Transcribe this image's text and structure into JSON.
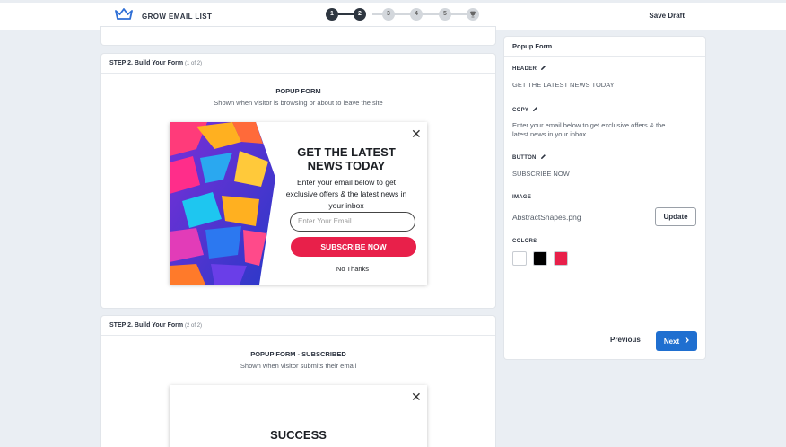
{
  "header": {
    "brand_label": "GROW EMAIL LIST",
    "steps": [
      "1",
      "2",
      "3",
      "4",
      "5"
    ],
    "current_step": 2,
    "save_label": "Save Draft"
  },
  "step1": {
    "heading": "STEP 2. Build Your Form",
    "heading_sub": "(1 of 2)",
    "form_title": "POPUP FORM",
    "form_desc": "Shown when visitor is browsing or about to leave the site",
    "popup": {
      "headline_line1": "GET THE LATEST",
      "headline_line2": "NEWS TODAY",
      "copy_line1": "Enter your email below to get",
      "copy_line2": "exclusive offers & the latest news in",
      "copy_line3": "your inbox",
      "input_placeholder": "Enter Your Email",
      "button_label": "SUBSCRIBE NOW",
      "no_thanks": "No Thanks",
      "close_glyph": "✕"
    }
  },
  "step2": {
    "heading": "STEP 2. Build Your Form",
    "heading_sub": "(2 of 2)",
    "form_title": "POPUP FORM - SUBSCRIBED",
    "form_desc": "Shown when visitor submits their email",
    "popup": {
      "headline": "SUCCESS",
      "close_glyph": "✕"
    }
  },
  "side": {
    "title": "Popup Form",
    "header_label": "HEADER",
    "header_value": "GET THE LATEST NEWS TODAY",
    "copy_label": "COPY",
    "copy_value_line1": "Enter your email below to get exclusive offers & the",
    "copy_value_line2": "latest news in your inbox",
    "button_label": "BUTTON",
    "button_value": "SUBSCRIBE NOW",
    "image_label": "IMAGE",
    "image_value": "AbstractShapes.png",
    "update_label": "Update",
    "colors_label": "COLORS",
    "previous_label": "Previous",
    "next_label": "Next"
  },
  "colors": {
    "accent_blue": "#1f6fd0",
    "subscribe_red": "#e8204a",
    "swatch_white": "#ffffff",
    "swatch_black": "#000000",
    "swatch_red": "#e8204a",
    "step_done": "#2e3640",
    "step_todo": "#d3d7dc",
    "brand_blue": "#2f6fd6"
  },
  "icons": {
    "brand": "crown-icon",
    "edit": "pencil-icon",
    "final_step": "trophy-icon",
    "next": "chevron-right-icon"
  }
}
